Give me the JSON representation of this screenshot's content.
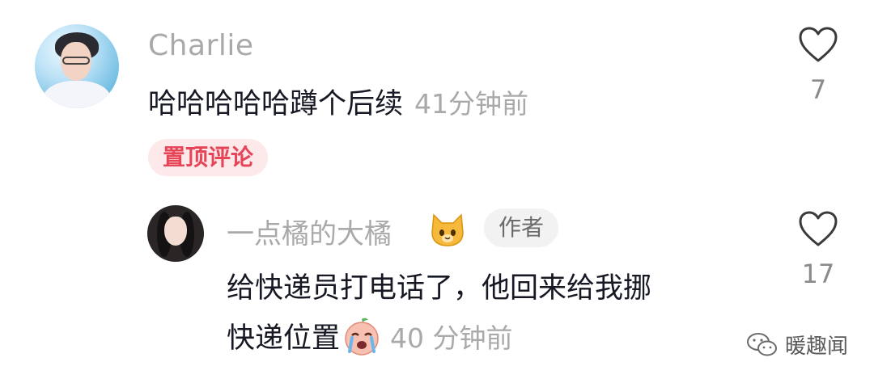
{
  "comment": {
    "username": "Charlie",
    "text": "哈哈哈哈哈蹲个后续",
    "time": "41分钟前",
    "likes": "7",
    "pin_badge": "置顶评论"
  },
  "reply": {
    "username": "一点橘的大橘",
    "author_badge": "作者",
    "text_line1": "给快递员打电话了，他回来给我挪",
    "text_line2": "快递位置",
    "time": "40 分钟前",
    "likes": "17"
  },
  "watermark": {
    "text": "暖趣闻"
  },
  "icons": {
    "like": "heart-outline-icon",
    "cat": "cat-face-emoji-icon",
    "cry": "crying-face-emoji-icon",
    "watermark": "wechat-icon"
  },
  "colors": {
    "text": "#161823",
    "muted": "#a9a9a9",
    "pin_bg": "#fde8ea",
    "pin_text": "#e64558"
  }
}
